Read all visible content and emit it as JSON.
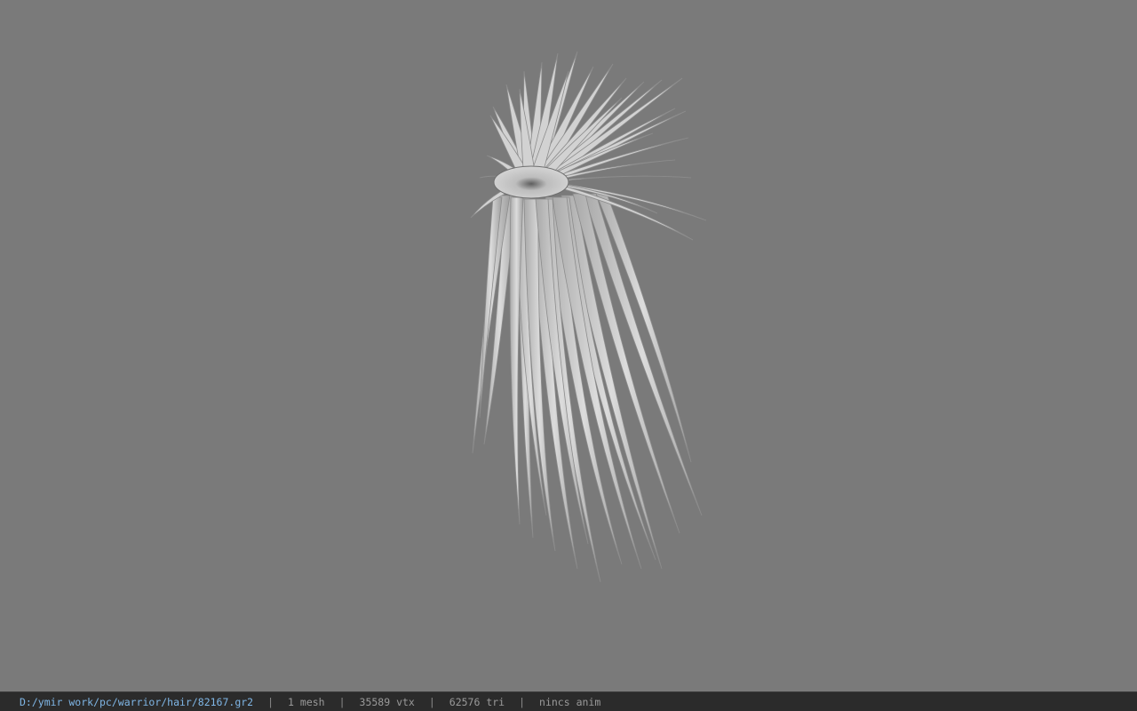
{
  "viewport": {
    "background_color": "#7a7a7a",
    "model_color": "#d2d2d2",
    "model_shade_color": "#8c8c8c"
  },
  "status": {
    "file_path": "D:/ymir work/pc/warrior/hair/82167.gr2",
    "mesh_count": "1 mesh",
    "vertex_count": "35589 vtx",
    "triangle_count": "62576 tri",
    "anim": "nincs anim",
    "separator": "|",
    "path_color": "#7fb6e6",
    "text_color": "#9a9a9a"
  }
}
